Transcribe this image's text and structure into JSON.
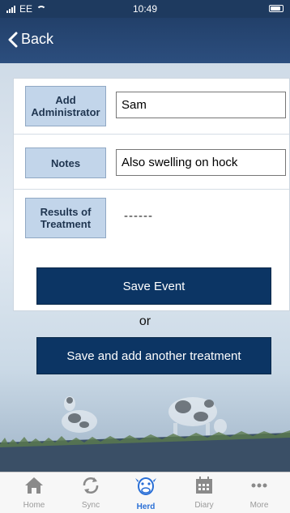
{
  "status_bar": {
    "carrier": "EE",
    "time": "10:49"
  },
  "nav": {
    "back_label": "Back"
  },
  "form": {
    "administrator": {
      "label_line1": "Add",
      "label_line2": "Administrator",
      "value": "Sam"
    },
    "notes": {
      "label": "Notes",
      "value": "Also swelling on hock"
    },
    "results": {
      "label_line1": "Results of",
      "label_line2": "Treatment",
      "value": "------"
    }
  },
  "actions": {
    "save_event": "Save Event",
    "or_text": "or",
    "save_add_another": "Save and add another treatment"
  },
  "tabs": [
    {
      "label": "Home",
      "icon": "home-icon"
    },
    {
      "label": "Sync",
      "icon": "sync-icon"
    },
    {
      "label": "Herd",
      "icon": "cow-icon",
      "active": true
    },
    {
      "label": "Diary",
      "icon": "calendar-icon"
    },
    {
      "label": "More",
      "icon": "more-icon"
    }
  ],
  "colors": {
    "nav_bg": "#22406a",
    "button_bg": "#0c3564",
    "label_bg": "#c2d5ea",
    "active_tab": "#2a6fd6"
  }
}
